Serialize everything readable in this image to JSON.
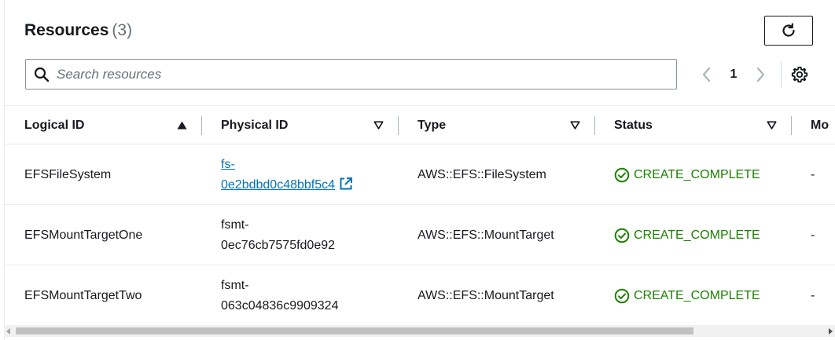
{
  "header": {
    "title": "Resources",
    "count": "(3)"
  },
  "search": {
    "placeholder": "Search resources",
    "value": ""
  },
  "pagination": {
    "current_page": "1"
  },
  "table": {
    "columns": [
      {
        "label": "Logical ID",
        "sort": "ascending"
      },
      {
        "label": "Physical ID",
        "sort": "none"
      },
      {
        "label": "Type",
        "sort": "none"
      },
      {
        "label": "Status",
        "sort": "none"
      },
      {
        "label": "Mo",
        "sort": "none"
      }
    ],
    "rows": [
      {
        "logical_id": "EFSFileSystem",
        "physical_id_line1": "fs-",
        "physical_id_line2": "0e2bdbd0c48bbf5c4",
        "physical_id_is_link": true,
        "type": "AWS::EFS::FileSystem",
        "status": "CREATE_COMPLETE",
        "module": "-"
      },
      {
        "logical_id": "EFSMountTargetOne",
        "physical_id_line1": "fsmt-",
        "physical_id_line2": "0ec76cb7575fd0e92",
        "physical_id_is_link": false,
        "type": "AWS::EFS::MountTarget",
        "status": "CREATE_COMPLETE",
        "module": "-"
      },
      {
        "logical_id": "EFSMountTargetTwo",
        "physical_id_line1": "fsmt-",
        "physical_id_line2": "063c04836c9909324",
        "physical_id_is_link": false,
        "type": "AWS::EFS::MountTarget",
        "status": "CREATE_COMPLETE",
        "module": "-"
      }
    ]
  },
  "icons": {
    "refresh": "refresh-icon",
    "search": "search-icon",
    "prev": "chevron-left-icon",
    "next": "chevron-right-icon",
    "settings": "gear-icon",
    "sort_asc": "caret-up-icon",
    "sort_none": "caret-down-outline-icon",
    "external_link": "external-link-icon",
    "status_success": "check-circle-icon"
  },
  "colors": {
    "link": "#0073bb",
    "success": "#1d8102",
    "text": "#16191f",
    "muted": "#687078"
  }
}
